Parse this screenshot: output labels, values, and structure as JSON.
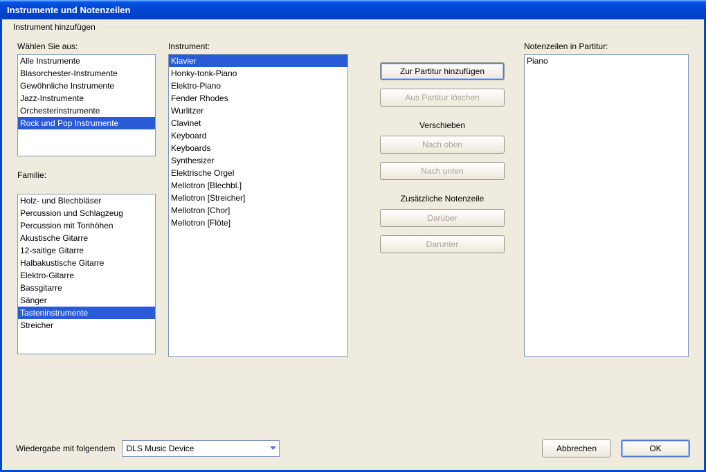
{
  "window": {
    "title": "Instrumente und Notenzeilen"
  },
  "group": {
    "label": "Instrument hinzufügen"
  },
  "choose": {
    "label": "Wählen Sie aus:",
    "items": [
      "Alle Instrumente",
      "Blasorchester-Instrumente",
      "Gewöhnliche Instrumente",
      "Jazz-Instrumente",
      "Orchesterinstrumente",
      "Rock und Pop Instrumente"
    ],
    "selected_index": 5
  },
  "family": {
    "label": "Familie:",
    "items": [
      "Holz- und Blechbläser",
      "Percussion und Schlagzeug",
      "Percussion mit Tonhöhen",
      "Akustische Gitarre",
      "12-saitige Gitarre",
      "Halbakustische Gitarre",
      "Elektro-Gitarre",
      "Bassgitarre",
      "Sänger",
      "Tasteninstrumente",
      "Streicher"
    ],
    "selected_index": 9
  },
  "instrument": {
    "label": "Instrument:",
    "items": [
      "Klavier",
      "Honky-tonk-Piano",
      "Elektro-Piano",
      "Fender Rhodes",
      "Wurlitzer",
      "Clavinet",
      "Keyboard",
      "Keyboards",
      "Synthesizer",
      "Elektrische Orgel",
      "Mellotron [Blechbl.]",
      "Mellotron [Streicher]",
      "Mellotron [Chor]",
      "Mellotron [Flöte]"
    ],
    "selected_index": 0
  },
  "actions": {
    "add": "Zur Partitur hinzufügen",
    "remove": "Aus Partitur löschen",
    "move_label": "Verschieben",
    "move_up": "Nach oben",
    "move_down": "Nach unten",
    "extra_label": "Zusätzliche Notenzeile",
    "above": "Darüber",
    "below": "Darunter"
  },
  "staves": {
    "label": "Notenzeilen in Partitur:",
    "items": [
      "Piano"
    ]
  },
  "playback": {
    "label": "Wiedergabe mit folgendem",
    "selected": "DLS Music Device"
  },
  "dialog": {
    "cancel": "Abbrechen",
    "ok": "OK"
  }
}
